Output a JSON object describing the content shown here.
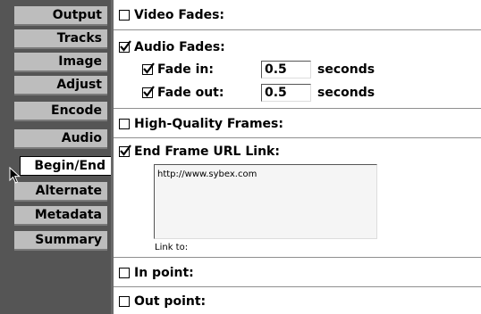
{
  "sidebar": {
    "tabs": [
      {
        "label": "Output"
      },
      {
        "label": "Tracks"
      },
      {
        "label": "Image"
      },
      {
        "label": "Adjust"
      },
      {
        "label": "Encode"
      },
      {
        "label": "Audio"
      },
      {
        "label": "Begin/End",
        "active": true
      },
      {
        "label": "Alternate"
      },
      {
        "label": "Metadata"
      },
      {
        "label": "Summary"
      }
    ]
  },
  "content": {
    "video_fades": {
      "label": "Video Fades:",
      "checked": false
    },
    "audio_fades": {
      "label": "Audio Fades:",
      "checked": true,
      "fade_in": {
        "label": "Fade in:",
        "checked": true,
        "value": "0.5",
        "unit": "seconds"
      },
      "fade_out": {
        "label": "Fade out:",
        "checked": true,
        "value": "0.5",
        "unit": "seconds"
      }
    },
    "high_quality_frames": {
      "label": "High-Quality Frames:",
      "checked": false
    },
    "end_frame_url_link": {
      "label": "End Frame URL Link:",
      "checked": true,
      "url": "http://www.sybex.com",
      "link_to_label": "Link to:"
    },
    "in_point": {
      "label": "In point:",
      "checked": false
    },
    "out_point": {
      "label": "Out point:",
      "checked": false
    }
  },
  "colors": {
    "sidebar_bg": "#555555",
    "tab_bg": "#bdbdbd",
    "active_tab_bg": "#ffffff"
  },
  "icons": {
    "cursor": "arrow-cursor-icon",
    "checkmark": "checkmark-icon"
  }
}
